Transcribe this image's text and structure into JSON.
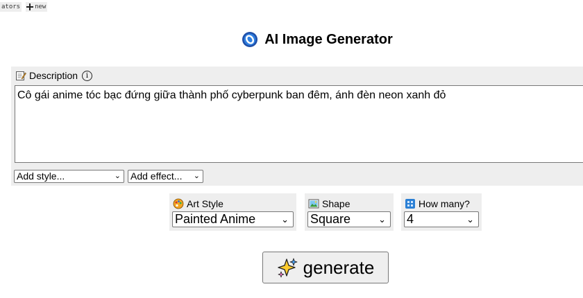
{
  "topbar": {
    "left_link": "ators",
    "new_link": "new"
  },
  "header": {
    "title": "AI Image Generator"
  },
  "description": {
    "label": "Description",
    "info_symbol": "i",
    "value": "Cô gái anime tóc bạc đứng giữa thành phố cyberpunk ban đêm, ánh đèn neon xanh đỏ",
    "add_style": "Add style...",
    "add_effect": "Add effect..."
  },
  "options": {
    "art_style": {
      "label": "Art Style",
      "value": "Painted Anime"
    },
    "shape": {
      "label": "Shape",
      "value": "Square"
    },
    "how_many": {
      "label": "How many?",
      "value": "4"
    }
  },
  "actions": {
    "generate_label": "generate"
  },
  "colors": {
    "panel": "#eeeeee",
    "border": "#777777",
    "button": "#efefef"
  }
}
